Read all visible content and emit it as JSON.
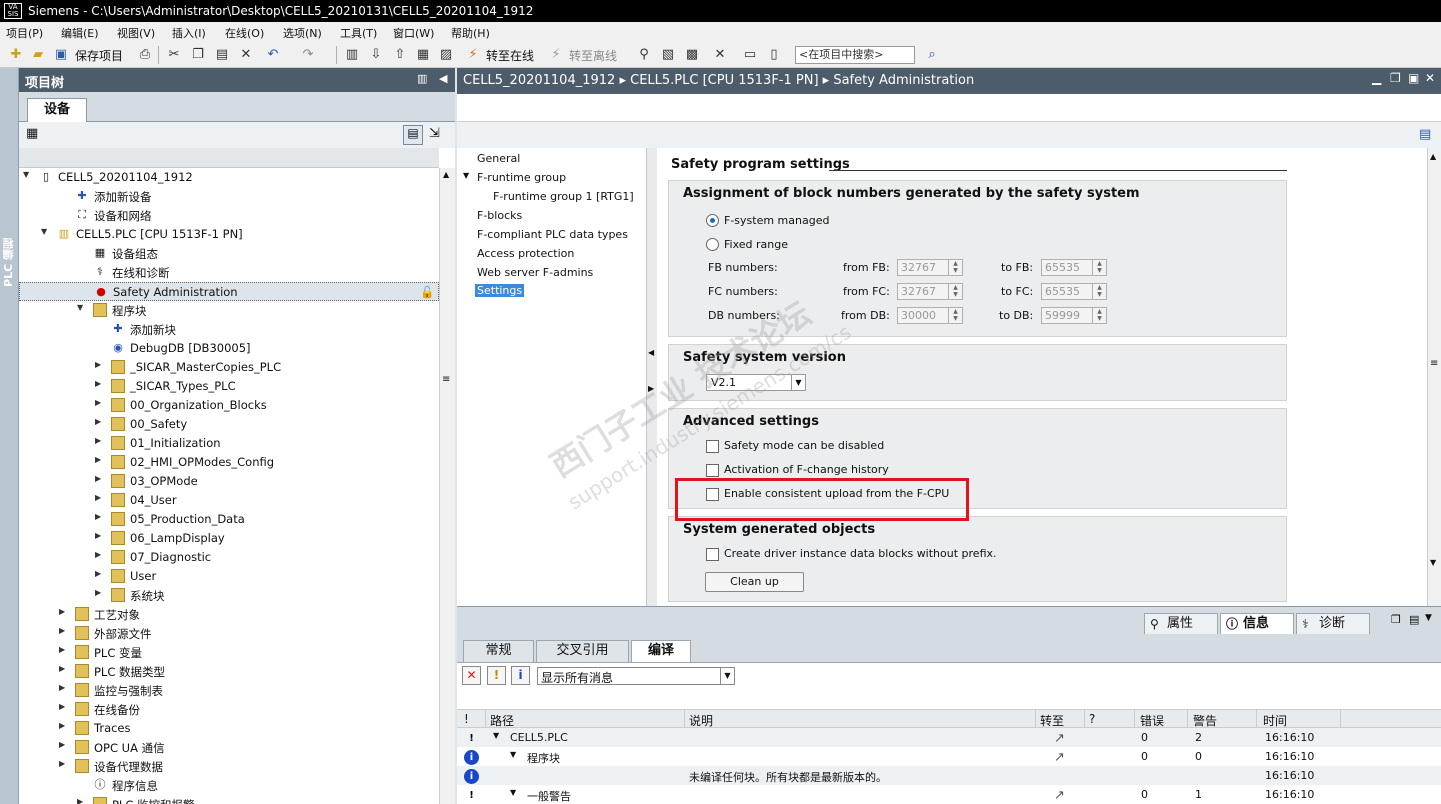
{
  "window": {
    "title": "Siemens  -  C:\\Users\\Administrator\\Desktop\\CELL5_20210131\\CELL5_20201104_1912",
    "logo": "VA SIS"
  },
  "menu": [
    "项目(P)",
    "编辑(E)",
    "视图(V)",
    "插入(I)",
    "在线(O)",
    "选项(N)",
    "工具(T)",
    "窗口(W)",
    "帮助(H)"
  ],
  "toolbar": {
    "save_project": "保存项目",
    "go_online": "转至在线",
    "go_offline": "转至离线",
    "search_placeholder": "<在项目中搜索>"
  },
  "left_strip": {
    "label": "PLC 编程"
  },
  "project_tree": {
    "title": "项目树",
    "devices_tab": "设备",
    "items": [
      {
        "label": "CELL5_20201104_1912",
        "icon": "project-icon"
      },
      {
        "label": "添加新设备",
        "icon": "add-device-icon"
      },
      {
        "label": "设备和网络",
        "icon": "network-icon"
      },
      {
        "label": "CELL5.PLC [CPU 1513F-1 PN]",
        "icon": "plc-icon"
      },
      {
        "label": "设备组态",
        "icon": "device-config-icon"
      },
      {
        "label": "在线和诊断",
        "icon": "diagnostics-icon"
      },
      {
        "label": "Safety Administration",
        "icon": "safety-icon"
      },
      {
        "label": "程序块",
        "icon": "folder-icon"
      },
      {
        "label": "添加新块",
        "icon": "add-block-icon"
      },
      {
        "label": "DebugDB [DB30005]",
        "icon": "db-icon"
      },
      {
        "label": "_SICAR_MasterCopies_PLC",
        "icon": "folder-icon"
      },
      {
        "label": "_SICAR_Types_PLC",
        "icon": "folder-icon"
      },
      {
        "label": "00_Organization_Blocks",
        "icon": "folder-icon"
      },
      {
        "label": "00_Safety",
        "icon": "folder-icon"
      },
      {
        "label": "01_Initialization",
        "icon": "folder-icon"
      },
      {
        "label": "02_HMI_OPModes_Config",
        "icon": "folder-icon"
      },
      {
        "label": "03_OPMode",
        "icon": "folder-icon"
      },
      {
        "label": "04_User",
        "icon": "folder-icon"
      },
      {
        "label": "05_Production_Data",
        "icon": "folder-icon"
      },
      {
        "label": "06_LampDisplay",
        "icon": "folder-icon"
      },
      {
        "label": "07_Diagnostic",
        "icon": "folder-icon"
      },
      {
        "label": "User",
        "icon": "folder-icon"
      },
      {
        "label": "系统块",
        "icon": "folder-icon"
      },
      {
        "label": "工艺对象",
        "icon": "folder-icon"
      },
      {
        "label": "外部源文件",
        "icon": "folder-icon"
      },
      {
        "label": "PLC 变量",
        "icon": "folder-icon"
      },
      {
        "label": "PLC 数据类型",
        "icon": "folder-icon"
      },
      {
        "label": "监控与强制表",
        "icon": "folder-icon"
      },
      {
        "label": "在线备份",
        "icon": "folder-icon"
      },
      {
        "label": "Traces",
        "icon": "folder-icon"
      },
      {
        "label": "OPC UA 通信",
        "icon": "folder-icon"
      },
      {
        "label": "设备代理数据",
        "icon": "folder-icon"
      },
      {
        "label": "程序信息",
        "icon": "info-icon"
      },
      {
        "label": "PLC 监控和报警",
        "icon": "folder-icon"
      }
    ]
  },
  "editor": {
    "breadcrumb": [
      "CELL5_20201104_1912",
      "CELL5.PLC [CPU 1513F-1 PN]",
      "Safety Administration"
    ],
    "nav": [
      "General",
      "F-runtime group",
      "F-runtime group 1 [RTG1]",
      "F-blocks",
      "F-compliant PLC data types",
      "Access protection",
      "Web server F-admins",
      "Settings"
    ],
    "section_title": "Safety program settings",
    "assign": {
      "title": "Assignment of block numbers generated by the safety system",
      "opt_managed": "F-system managed",
      "opt_fixed": "Fixed range",
      "rows": [
        {
          "label": "FB numbers:",
          "from_label": "from FB:",
          "from": "32767",
          "to_label": "to FB:",
          "to": "65535"
        },
        {
          "label": "FC numbers:",
          "from_label": "from FC:",
          "from": "32767",
          "to_label": "to FC:",
          "to": "65535"
        },
        {
          "label": "DB numbers:",
          "from_label": "from DB:",
          "from": "30000",
          "to_label": "to DB:",
          "to": "59999"
        }
      ]
    },
    "version": {
      "title": "Safety system version",
      "value": "V2.1"
    },
    "advanced": {
      "title": "Advanced settings",
      "opt1": "Safety mode can be disabled",
      "opt2": "Activation of F-change history",
      "opt3": "Enable consistent upload from the F-CPU"
    },
    "sysgen": {
      "title": "System generated objects",
      "opt1": "Create driver instance data blocks without prefix.",
      "cleanup": "Clean up"
    },
    "watermark": {
      "cn": "西门子工业  技术论坛",
      "url": "support.industry.siemens.com/cs"
    }
  },
  "inspector": {
    "tabs": [
      "属性",
      "信息",
      "诊断"
    ],
    "subtabs": [
      "常规",
      "交叉引用",
      "编译"
    ],
    "filter": "显示所有消息",
    "columns": [
      "!",
      "路径",
      "说明",
      "转至",
      "?",
      "错误",
      "警告",
      "时间"
    ],
    "rows": [
      {
        "sev": "warn",
        "path": "CELL5.PLC",
        "desc": "",
        "err": "0",
        "warn": "2",
        "time": "16:16:10"
      },
      {
        "sev": "info",
        "path": "程序块",
        "desc": "",
        "err": "0",
        "warn": "0",
        "time": "16:16:10"
      },
      {
        "sev": "info",
        "path": "",
        "desc": "未编译任何块。所有块都是最新版本的。",
        "err": "",
        "warn": "",
        "time": "16:16:10"
      },
      {
        "sev": "warn",
        "path": "一般警告",
        "desc": "",
        "err": "0",
        "warn": "1",
        "time": "16:16:10"
      }
    ]
  },
  "colors": {
    "header": "#4c5c6a",
    "highlight": "#e1141a",
    "selection": "#3c8ad9"
  }
}
